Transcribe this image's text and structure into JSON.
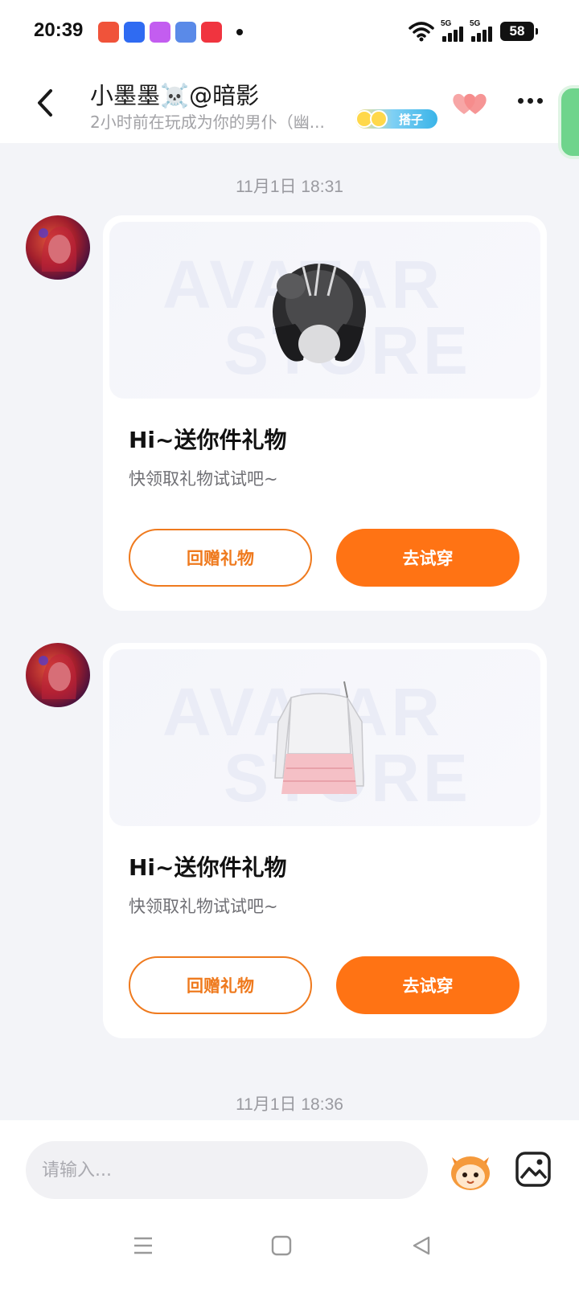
{
  "status_bar": {
    "time": "20:39",
    "battery": "58",
    "network_1": "5G",
    "network_2": "5G",
    "app_icon_colors": [
      "#f0533a",
      "#2f6bf2",
      "#c35df0",
      "#5a8ae8",
      "#f0343f"
    ]
  },
  "header": {
    "title": "小墨墨☠️@暗影",
    "subtitle": "2小时前在玩成为你的男仆（幽...",
    "badge_label": "搭子"
  },
  "messages": [
    {
      "timestamp": "11月1日 18:31",
      "gift_title": "Hi~送你件礼物",
      "gift_desc": "快领取礼物试试吧~",
      "return_label": "回赠礼物",
      "try_label": "去试穿",
      "item": "hair"
    },
    {
      "gift_title": "Hi~送你件礼物",
      "gift_desc": "快领取礼物试试吧~",
      "return_label": "回赠礼物",
      "try_label": "去试穿",
      "item": "dress"
    }
  ],
  "last_timestamp": "11月1日 18:36",
  "watermark": {
    "line1": "AVATAR",
    "line2": "STORE"
  },
  "input": {
    "placeholder": "请输入..."
  },
  "colors": {
    "accent": "#ff7314",
    "outline": "#ef7a1e",
    "background": "#f3f4f8"
  }
}
